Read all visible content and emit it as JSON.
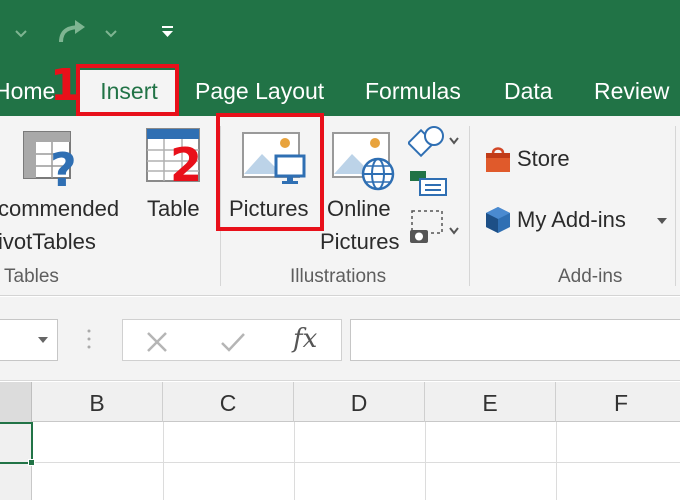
{
  "quick_access": {
    "icons": [
      "undo-dropdown-icon",
      "redo-icon",
      "redo-dropdown-icon",
      "customize-qat-icon"
    ]
  },
  "tabs": [
    {
      "label": "Home"
    },
    {
      "label": "Insert",
      "active": true
    },
    {
      "label": "Page Layout"
    },
    {
      "label": "Formulas"
    },
    {
      "label": "Data"
    },
    {
      "label": "Review"
    }
  ],
  "ribbon": {
    "tables_group": {
      "label": "Tables",
      "recommended_line1": "commended",
      "recommended_line2": "ivotTables",
      "table_label": "Table"
    },
    "illustrations_group": {
      "label": "Illustrations",
      "pictures_label": "Pictures",
      "online_line1": "Online",
      "online_line2": "Pictures"
    },
    "addins_group": {
      "label": "Add-ins",
      "store_label": "Store",
      "myaddins_label": "My Add-ins"
    }
  },
  "formula_bar": {
    "fx_label": "fx"
  },
  "grid": {
    "columns": [
      "B",
      "C",
      "D",
      "E",
      "F"
    ]
  },
  "annotations": {
    "step1": "1",
    "step2": "2"
  },
  "colors": {
    "excel_green": "#217346",
    "annotation_red": "#e8101a"
  }
}
